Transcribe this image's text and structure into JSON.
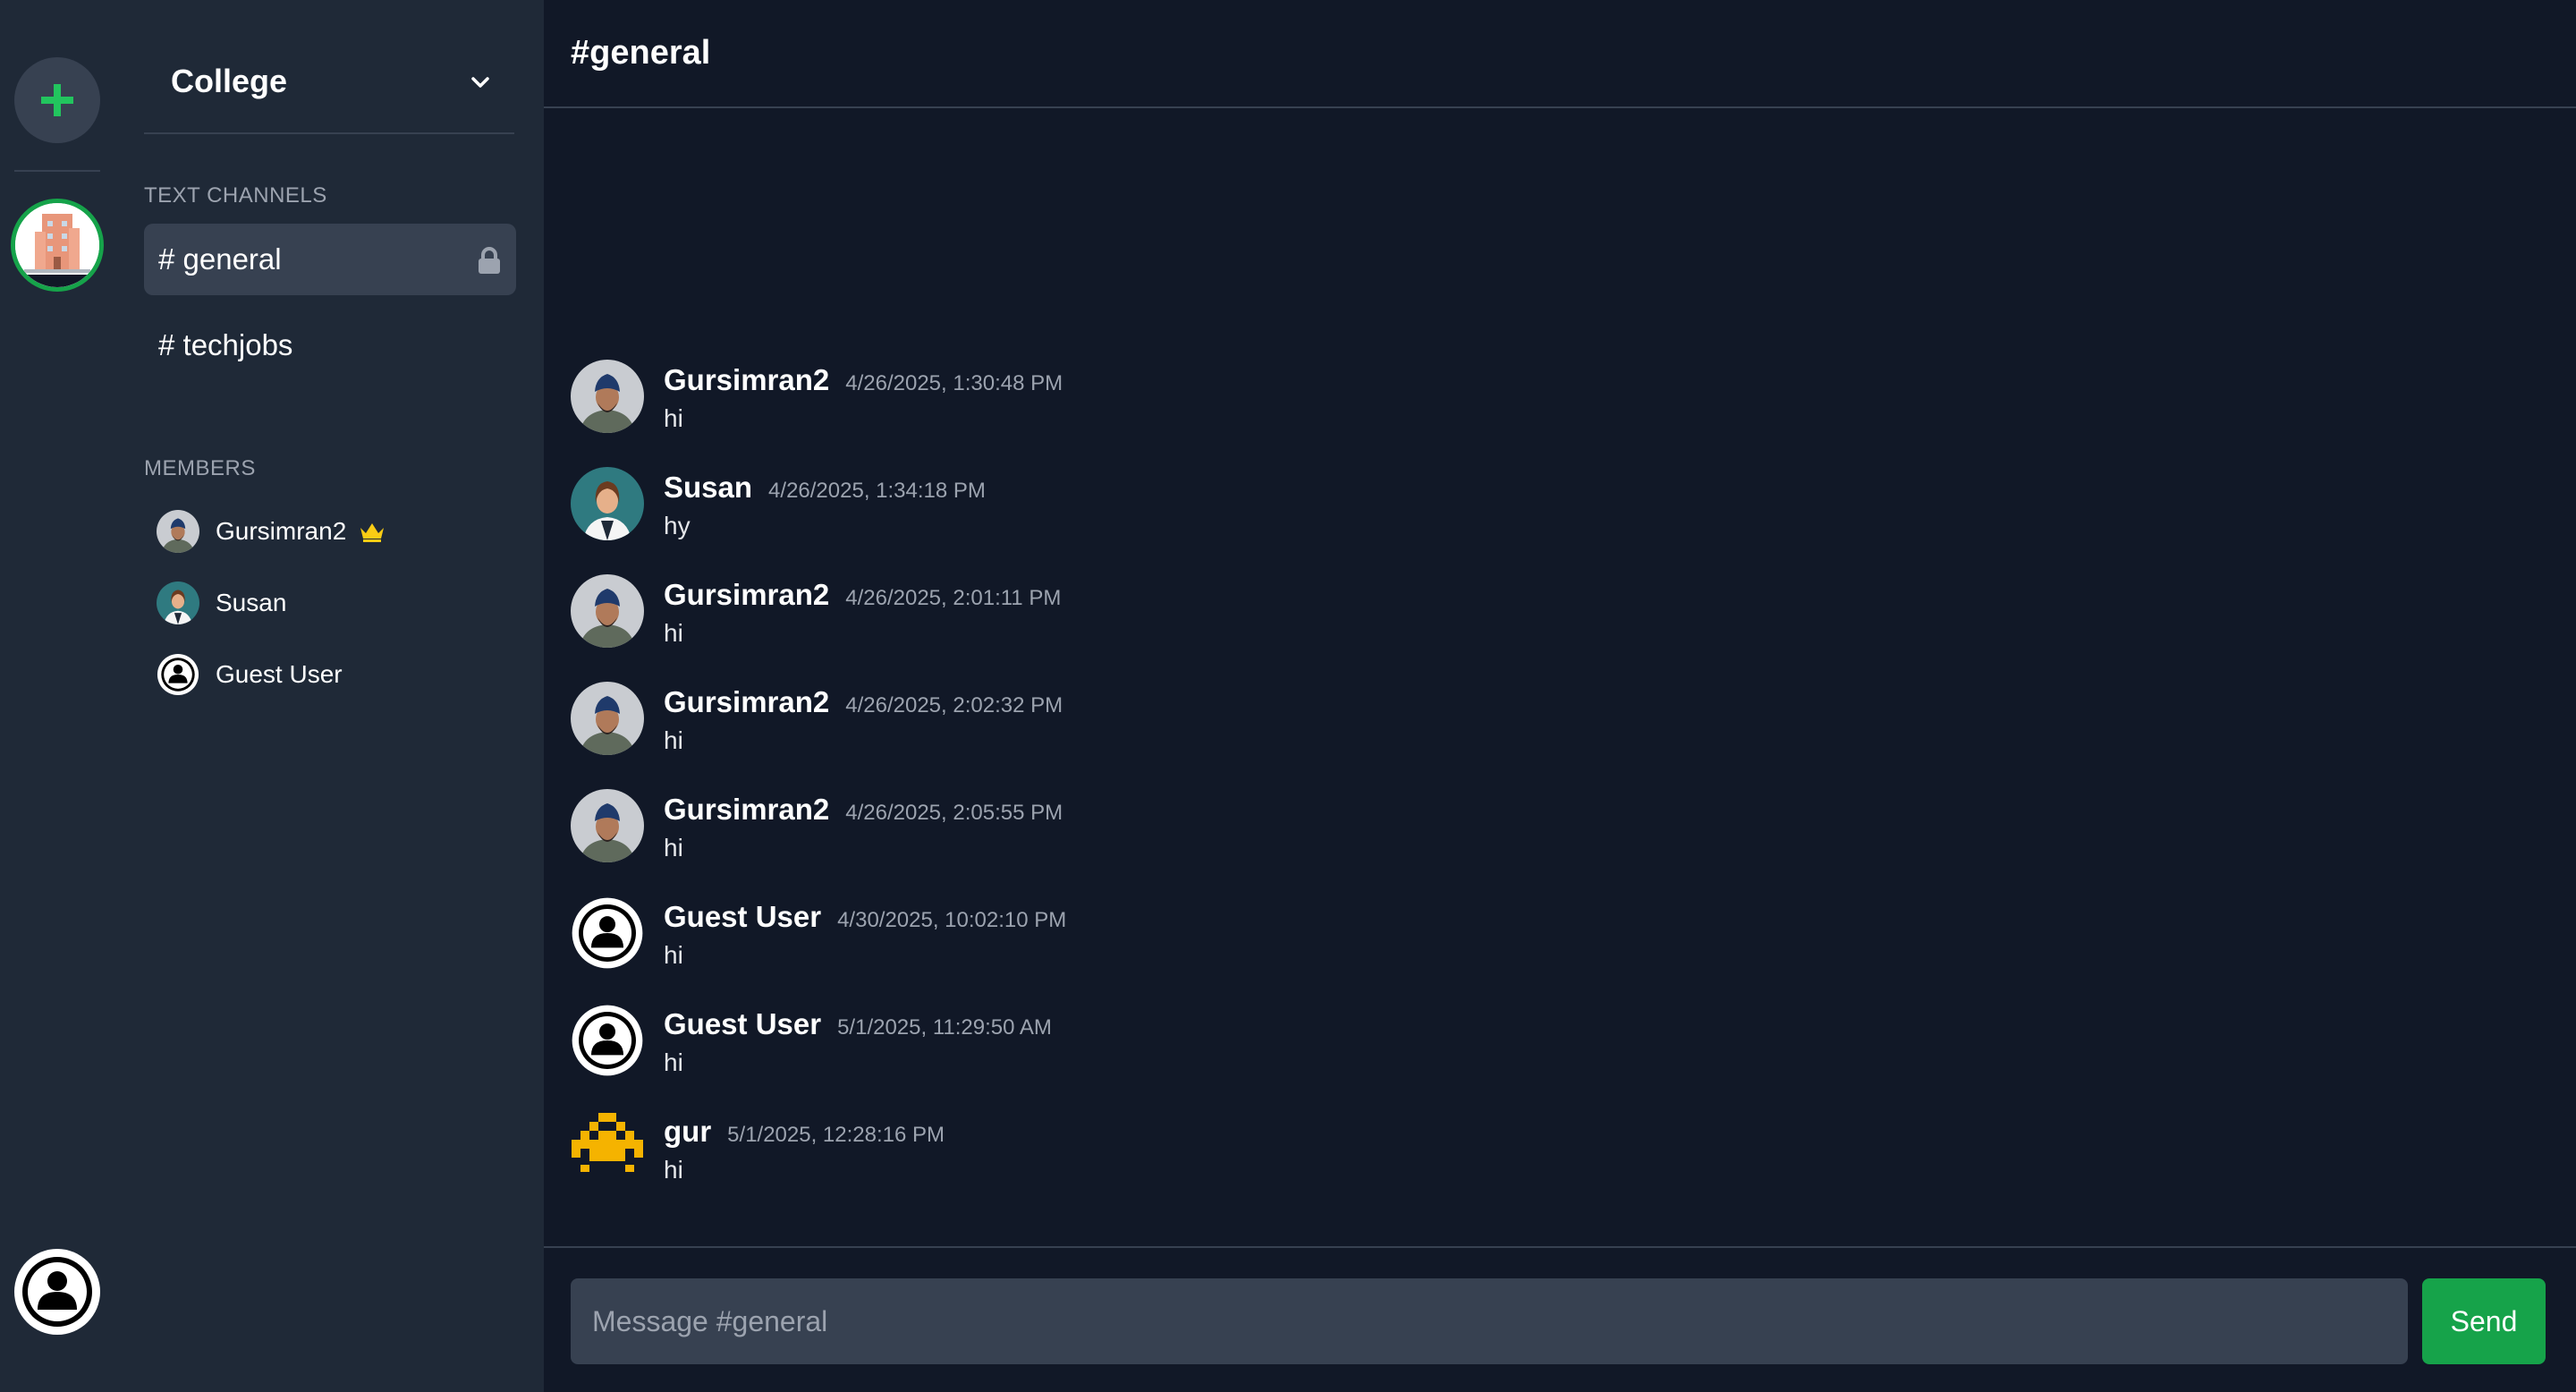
{
  "server": {
    "name": "College",
    "add_server_icon": "plus-icon",
    "chevron_icon": "chevron-down-icon"
  },
  "sections": {
    "text_channels": "TEXT CHANNELS",
    "members": "MEMBERS"
  },
  "channels": [
    {
      "label": "# general",
      "active": true,
      "locked": true
    },
    {
      "label": "# techjobs",
      "active": false,
      "locked": false
    }
  ],
  "members": [
    {
      "name": "Gursimran2",
      "avatar": "turban-man",
      "owner": true
    },
    {
      "name": "Susan",
      "avatar": "woman",
      "owner": false
    },
    {
      "name": "Guest User",
      "avatar": "default-user",
      "owner": false
    }
  ],
  "chat": {
    "title": "#general",
    "placeholder": "Message #general",
    "send_label": "Send"
  },
  "messages": [
    {
      "author": "Gursimran2",
      "time": "4/26/2025, 1:30:48 PM",
      "text": "hi",
      "avatar": "turban-man"
    },
    {
      "author": "Susan",
      "time": "4/26/2025, 1:34:18 PM",
      "text": "hy",
      "avatar": "woman"
    },
    {
      "author": "Gursimran2",
      "time": "4/26/2025, 2:01:11 PM",
      "text": "hi",
      "avatar": "turban-man"
    },
    {
      "author": "Gursimran2",
      "time": "4/26/2025, 2:02:32 PM",
      "text": "hi",
      "avatar": "turban-man"
    },
    {
      "author": "Gursimran2",
      "time": "4/26/2025, 2:05:55 PM",
      "text": "hi",
      "avatar": "turban-man"
    },
    {
      "author": "Guest User",
      "time": "4/30/2025, 10:02:10 PM",
      "text": "hi",
      "avatar": "default-user"
    },
    {
      "author": "Guest User",
      "time": "5/1/2025, 11:29:50 AM",
      "text": "hi",
      "avatar": "default-user"
    },
    {
      "author": "gur",
      "time": "5/1/2025, 12:28:16 PM",
      "text": "hi",
      "avatar": "pixel-invader"
    }
  ],
  "colors": {
    "accent": "#16a34a",
    "sidebar_bg": "#1f2937",
    "main_bg": "#111827",
    "crown": "#facc15",
    "pixel_avatar": "#f5b300"
  }
}
